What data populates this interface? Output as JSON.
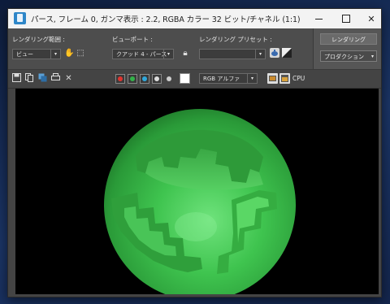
{
  "window": {
    "title": "パース, フレーム 0, ガンマ表示 : 2.2, RGBA カラー 32 ビット/チャネル (1:1)"
  },
  "settings": {
    "area_label": "レンダリング範囲 :",
    "area_value": "ビュー",
    "viewport_label": "ビューポート :",
    "viewport_value": "クアッド 4 - パース",
    "preset_label": "レンダリング プリセット :",
    "preset_value": "",
    "render_button": "レンダリング",
    "mode_value": "プロダクション"
  },
  "toolbar": {
    "channel_value": "RGB アルファ",
    "renderer_label": "CPU"
  },
  "colors": {
    "red_channel": "#e0342f",
    "green_channel": "#33b24a",
    "blue_channel": "#2fa8dc",
    "sphere": "#3fc44f"
  },
  "icons": [
    "save-icon",
    "copy-icon",
    "clone-icon",
    "print-icon",
    "clear-icon",
    "lock-icon",
    "teapot-icon",
    "color-correct-icon"
  ]
}
